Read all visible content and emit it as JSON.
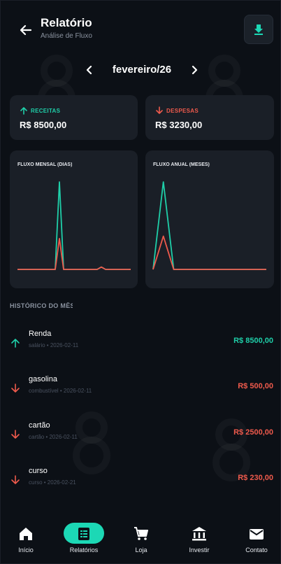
{
  "header": {
    "title": "Relatório",
    "subtitle": "Análise de Fluxo"
  },
  "month_nav": {
    "label": "fevereiro/26"
  },
  "summary": {
    "income_label": "RECEITAS",
    "income_value": "R$ 8500,00",
    "expense_label": "DESPESAS",
    "expense_value": "R$ 3230,00"
  },
  "colors": {
    "income": "#1fcfa9",
    "expense": "#ef5a4c",
    "accent": "#1cd8b5",
    "card": "#1a1f27"
  },
  "charts": {
    "monthly_title": "FLUXO MENSAL (DIAS)",
    "annual_title": "FLUXO ANUAL (MESES)"
  },
  "chart_data": [
    {
      "type": "line",
      "title": "FLUXO MENSAL (DIAS)",
      "x": [
        1,
        2,
        3,
        4,
        5,
        6,
        7,
        8,
        9,
        10,
        11,
        12,
        13,
        14,
        15,
        16,
        17,
        18,
        19,
        20,
        21,
        22,
        23,
        24,
        25,
        26,
        27,
        28
      ],
      "series": [
        {
          "values": [
            0,
            0,
            0,
            0,
            0,
            0,
            0,
            0,
            0,
            0,
            8500,
            0,
            0,
            0,
            0,
            0,
            0,
            0,
            0,
            0,
            230,
            0,
            0,
            0,
            0,
            0,
            0,
            0
          ]
        },
        {
          "values": [
            0,
            0,
            0,
            0,
            0,
            0,
            0,
            0,
            0,
            0,
            3000,
            0,
            0,
            0,
            0,
            0,
            0,
            0,
            0,
            0,
            230,
            0,
            0,
            0,
            0,
            0,
            0,
            0
          ]
        }
      ],
      "ylim": [
        0,
        8500
      ]
    },
    {
      "type": "line",
      "title": "FLUXO ANUAL (MESES)",
      "x": [
        1,
        2,
        3,
        4,
        5,
        6,
        7,
        8,
        9,
        10,
        11,
        12
      ],
      "series": [
        {
          "values": [
            0,
            8500,
            0,
            0,
            0,
            0,
            0,
            0,
            0,
            0,
            0,
            0
          ]
        },
        {
          "values": [
            0,
            3230,
            0,
            0,
            0,
            0,
            0,
            0,
            0,
            0,
            0,
            0
          ]
        }
      ],
      "ylim": [
        0,
        8500
      ]
    }
  ],
  "history": {
    "title": "HISTÓRICO DO MÊS",
    "items": [
      {
        "name": "Renda",
        "meta": "salário • 2026-02-11",
        "amount": "R$ 8500,00",
        "kind": "income"
      },
      {
        "name": "gasolina",
        "meta": "combustível • 2026-02-11",
        "amount": "R$ 500,00",
        "kind": "expense"
      },
      {
        "name": "cartão",
        "meta": "cartão • 2026-02-11",
        "amount": "R$ 2500,00",
        "kind": "expense"
      },
      {
        "name": "curso",
        "meta": "curso • 2026-02-21",
        "amount": "R$ 230,00",
        "kind": "expense"
      }
    ]
  },
  "nav": {
    "items": [
      {
        "label": "Início",
        "icon": "home-icon"
      },
      {
        "label": "Relatórios",
        "icon": "report-icon",
        "active": true
      },
      {
        "label": "Loja",
        "icon": "cart-icon"
      },
      {
        "label": "Investir",
        "icon": "bank-icon"
      },
      {
        "label": "Contato",
        "icon": "mail-icon"
      }
    ]
  }
}
